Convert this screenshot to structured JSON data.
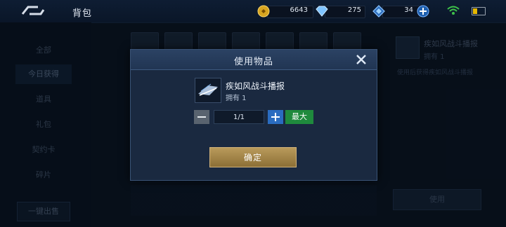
{
  "header": {
    "title": "背包",
    "currencies": [
      {
        "name": "gold-coin",
        "value": "6643",
        "color": "#d8a520"
      },
      {
        "name": "diamond",
        "value": "275",
        "color": "#7fc4ff"
      },
      {
        "name": "crystal",
        "value": "34",
        "color": "#58a6ff"
      }
    ]
  },
  "sidebar": {
    "items": [
      {
        "label": "全部"
      },
      {
        "label": "今日获得"
      },
      {
        "label": "道具"
      },
      {
        "label": "礼包"
      },
      {
        "label": "契约卡"
      },
      {
        "label": "碎片"
      }
    ],
    "sell_label": "一键出售"
  },
  "right_panel": {
    "name": "疾如风战斗播报",
    "owned": "拥有 1",
    "desc": "使用后获得疾如风战斗播报",
    "use_label": "使用"
  },
  "modal": {
    "title": "使用物品",
    "item_name": "疾如风战斗播报",
    "owned": "拥有 1",
    "quantity": "1/1",
    "max_label": "最大",
    "confirm_label": "确定"
  },
  "colors": {
    "accent_gold": "#b99a5b",
    "max_green": "#1f8a3d",
    "plus_blue": "#2a6cc0"
  }
}
